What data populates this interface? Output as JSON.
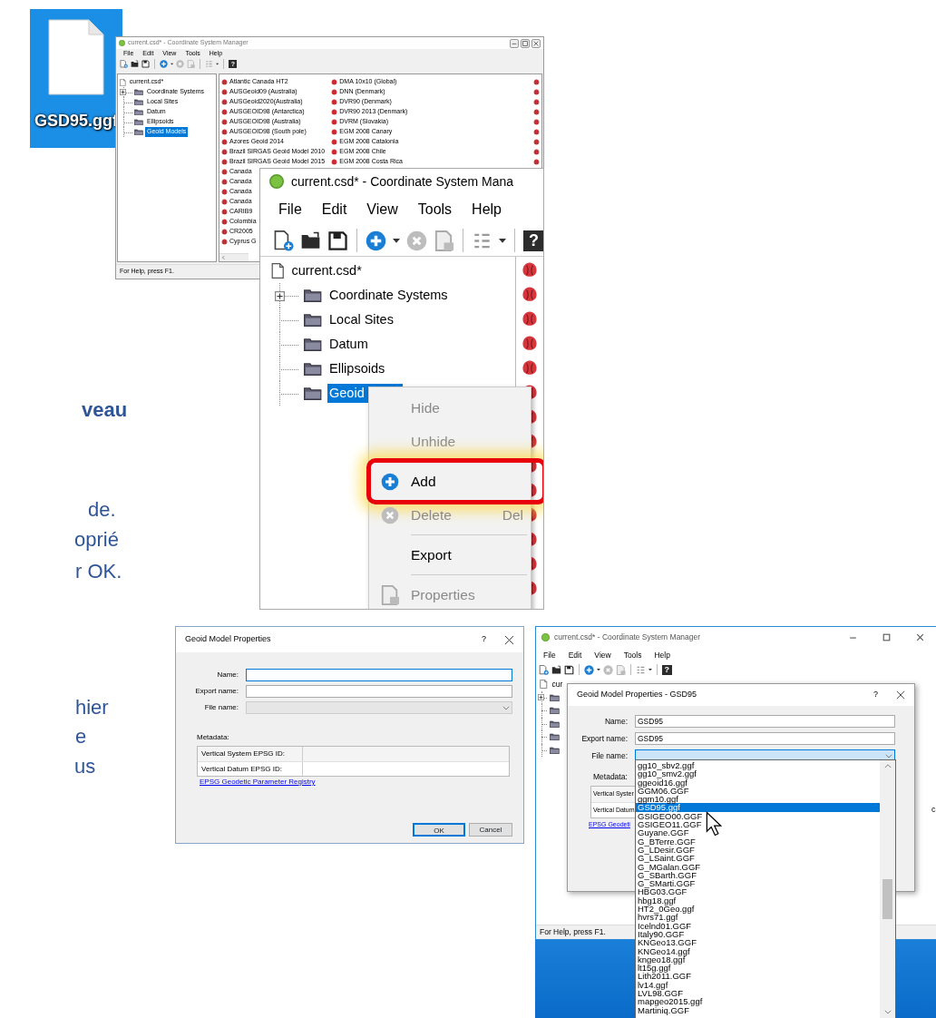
{
  "file_icon": {
    "label": "GSD95.ggf",
    "selected": true
  },
  "slide_text": [
    {
      "text": "veau",
      "bold": true
    },
    {
      "text": "de.",
      "bold": false
    },
    {
      "text": "oprié",
      "bold": false
    },
    {
      "text": "r OK.",
      "bold": false
    },
    {
      "text": "hier",
      "bold": false
    },
    {
      "text": "e",
      "bold": false
    },
    {
      "text": "us",
      "bold": false
    }
  ],
  "window_overview": {
    "title": "current.csd* - Coordinate System Manager",
    "menu": [
      "File",
      "Edit",
      "View",
      "Tools",
      "Help"
    ],
    "help_glyph": "?",
    "tree": [
      {
        "label": "current.csd*",
        "selected": false,
        "children": [
          {
            "label": "Coordinate Systems",
            "kind": "collapsed",
            "selected": false
          },
          {
            "label": "Local Sites",
            "kind": "leaf",
            "selected": false
          },
          {
            "label": "Datum",
            "kind": "leaf",
            "selected": false
          },
          {
            "label": "Ellipsoids",
            "kind": "leaf",
            "selected": false
          },
          {
            "label": "Geoid Models",
            "kind": "leaf",
            "selected": true
          }
        ]
      }
    ],
    "list_columns": [
      [
        "Atlantic Canada HT2",
        "AUSGeoid09 (Australia)",
        "AUSGeoid2020(Australia)",
        "AUSGEOID98 (Antarctica)",
        "AUSGEOID98 (Australia)",
        "AUSGEOID98 (South pole)",
        "Azores Geoid 2014",
        "Brazil SIRGAS Geoid Model 2010",
        "Brazil SIRGAS Geoid Model 2015",
        "Canada",
        "Canada",
        "Canada",
        "Canada",
        "CARIB9",
        "Colombia",
        "CR2005",
        "Cyprus G"
      ],
      [
        "DMA 10x10 (Global)",
        "DNN (Denmark)",
        "DVR90 (Denmark)",
        "DVR90 2013 (Denmark)",
        "DVRM (Slovakia)",
        "EGM 2008 Canary",
        "EGM 2008 Catalonia",
        "EGM 2008 Chile",
        "EGM 2008 Costa Rica"
      ]
    ],
    "status_bar": "For Help, press F1."
  },
  "window_zoomed": {
    "title": "current.csd* - Coordinate System Mana",
    "menu": [
      "File",
      "Edit",
      "View",
      "Tools",
      "Help"
    ],
    "help_glyph": "?",
    "tree": [
      {
        "label": "current.csd*",
        "selected": false,
        "children": [
          {
            "label": "Coordinate Systems",
            "kind": "collapsed",
            "selected": false
          },
          {
            "label": "Local Sites",
            "kind": "leaf",
            "selected": false
          },
          {
            "label": "Datum",
            "kind": "leaf",
            "selected": false
          },
          {
            "label": "Ellipsoids",
            "kind": "leaf",
            "selected": false
          },
          {
            "label": "Geoid",
            "kind": "leaf",
            "selected": true
          }
        ]
      }
    ],
    "context_menu": [
      {
        "kind": "item",
        "label": "Hide",
        "disabled": true,
        "highlighted": false
      },
      {
        "kind": "item",
        "label": "Unhide",
        "disabled": true,
        "highlighted": false
      },
      {
        "kind": "separator"
      },
      {
        "kind": "add",
        "label": "Add",
        "disabled": false,
        "highlighted": true
      },
      {
        "kind": "delete",
        "label": "Delete",
        "shortcut": "Del",
        "disabled": true,
        "highlighted": false
      },
      {
        "kind": "separator"
      },
      {
        "kind": "item",
        "label": "Export",
        "disabled": false,
        "highlighted": false
      },
      {
        "kind": "separator"
      },
      {
        "kind": "properties",
        "label": "Properties",
        "disabled": true,
        "highlighted": false
      }
    ]
  },
  "dialog_empty": {
    "title": "Geoid Model Properties",
    "help": "?",
    "fields": [
      {
        "label": "Name:",
        "kind": "text",
        "focused": true,
        "disabled": false
      },
      {
        "label": "Export name:",
        "kind": "text",
        "focused": false,
        "disabled": false
      },
      {
        "label": "File name:",
        "kind": "combo",
        "focused": false,
        "disabled": true
      }
    ],
    "metadata_label": "Metadata:",
    "metadata_rows": [
      "Vertical System EPSG ID:",
      "Vertical Datum EPSG ID:"
    ],
    "link": "EPSG Geodetic Parameter Registry",
    "buttons": [
      {
        "label": "OK",
        "default": true
      },
      {
        "label": "Cancel",
        "default": false
      }
    ]
  },
  "window_dropdown": {
    "title": "current.csd* - Coordinate System Manager",
    "menu": [
      "File",
      "Edit",
      "View",
      "Tools",
      "Help"
    ],
    "help_glyph": "?",
    "tree": [
      {
        "label": "cur",
        "selected": false,
        "children": [
          {
            "kind": "collapsed"
          },
          {
            "kind": "leaf"
          },
          {
            "kind": "leaf"
          },
          {
            "kind": "leaf"
          },
          {
            "kind": "leaf"
          }
        ]
      }
    ],
    "fragment": "c",
    "status_bar": "For Help, press F1.",
    "dialog": {
      "title": "Geoid Model Properties - GSD95",
      "help": "?",
      "fields": [
        {
          "label": "Name:",
          "kind": "text",
          "value": "GSD95",
          "focused": false,
          "disabled": false
        },
        {
          "label": "Export name:",
          "kind": "text",
          "value": "GSD95",
          "focused": false,
          "disabled": false
        },
        {
          "label": "File name:",
          "kind": "combo",
          "focused": true,
          "disabled": false
        }
      ],
      "metadata_label": "Metadata:",
      "metadata_rows": [
        "Vertical Syster",
        "Vertical Datum"
      ],
      "link": "EPSG Geodeti"
    },
    "dropdown": [
      {
        "label": "gg10_sbv2.ggf",
        "selected": false
      },
      {
        "label": "gg10_smv2.ggf",
        "selected": false
      },
      {
        "label": "ggeoid16.ggf",
        "selected": false
      },
      {
        "label": "GGM06.GGF",
        "selected": false
      },
      {
        "label": "ggm10.ggf",
        "selected": false
      },
      {
        "label": "GSD95.ggf",
        "selected": true
      },
      {
        "label": "GSIGEO00.GGF",
        "selected": false
      },
      {
        "label": "GSIGEO11.GGF",
        "selected": false
      },
      {
        "label": "Guyane.GGF",
        "selected": false
      },
      {
        "label": "G_BTerre.GGF",
        "selected": false
      },
      {
        "label": "G_LDesir.GGF",
        "selected": false
      },
      {
        "label": "G_LSaint.GGF",
        "selected": false
      },
      {
        "label": "G_MGalan.GGF",
        "selected": false
      },
      {
        "label": "G_SBarth.GGF",
        "selected": false
      },
      {
        "label": "G_SMarti.GGF",
        "selected": false
      },
      {
        "label": "HBG03.GGF",
        "selected": false
      },
      {
        "label": "hbg18.ggf",
        "selected": false
      },
      {
        "label": "HT2_0Geo.ggf",
        "selected": false
      },
      {
        "label": "hvrs71.ggf",
        "selected": false
      },
      {
        "label": "Icelnd01.GGF",
        "selected": false
      },
      {
        "label": "Italy90.GGF",
        "selected": false
      },
      {
        "label": "KNGeo13.GGF",
        "selected": false
      },
      {
        "label": "KNGeo14.ggf",
        "selected": false
      },
      {
        "label": "kngeo18.ggf",
        "selected": false
      },
      {
        "label": "lt15g.ggf",
        "selected": false
      },
      {
        "label": "Lith2011.GGF",
        "selected": false
      },
      {
        "label": "lv14.ggf",
        "selected": false
      },
      {
        "label": "LVL98.GGF",
        "selected": false
      },
      {
        "label": "mapgeo2015.ggf",
        "selected": false
      },
      {
        "label": "Martiniq.GGF",
        "selected": false
      }
    ]
  }
}
